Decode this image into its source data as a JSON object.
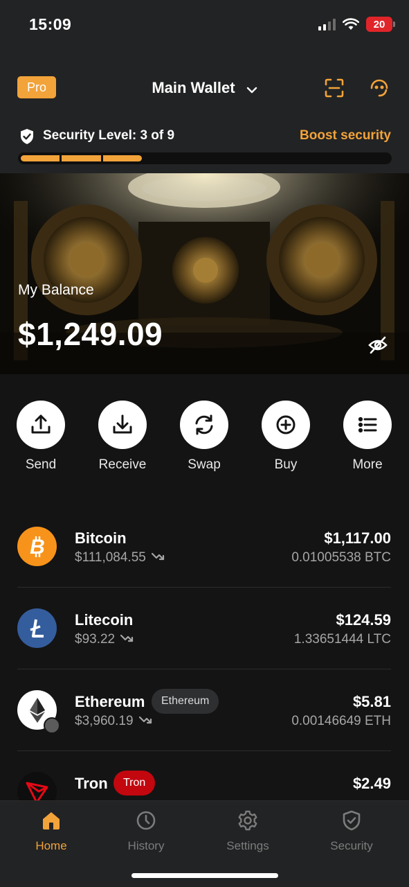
{
  "status": {
    "time": "15:09",
    "battery": "20"
  },
  "header": {
    "pro_badge": "Pro",
    "wallet_name": "Main Wallet"
  },
  "security": {
    "label": "Security Level: 3 of 9",
    "boost": "Boost security",
    "level": 3,
    "max": 9
  },
  "balance": {
    "label": "My Balance",
    "value": "$1,249.09"
  },
  "actions": [
    {
      "label": "Send",
      "icon": "send-icon"
    },
    {
      "label": "Receive",
      "icon": "receive-icon"
    },
    {
      "label": "Swap",
      "icon": "swap-icon"
    },
    {
      "label": "Buy",
      "icon": "buy-icon"
    },
    {
      "label": "More",
      "icon": "more-icon"
    }
  ],
  "assets": [
    {
      "name": "Bitcoin",
      "price": "$111,084.55",
      "fiat": "$1,117.00",
      "amount": "0.01005538 BTC",
      "color": "#f7931a"
    },
    {
      "name": "Litecoin",
      "price": "$93.22",
      "fiat": "$124.59",
      "amount": "1.33651444 LTC",
      "color": "#345d9d"
    },
    {
      "name": "Ethereum",
      "chip": "Ethereum",
      "price": "$3,960.19",
      "fiat": "$5.81",
      "amount": "0.00146649 ETH",
      "color": "#ffffff"
    },
    {
      "name": "Tron",
      "chip": "Tron",
      "fiat": "$2.49",
      "color": "#e50915"
    }
  ],
  "tabs": [
    {
      "label": "Home",
      "icon": "home-icon",
      "active": true
    },
    {
      "label": "History",
      "icon": "clock-icon"
    },
    {
      "label": "Settings",
      "icon": "gear-icon"
    },
    {
      "label": "Security",
      "icon": "shield-icon"
    }
  ],
  "colors": {
    "accent": "#f2a33a",
    "background": "#141414",
    "panel": "#222324"
  }
}
